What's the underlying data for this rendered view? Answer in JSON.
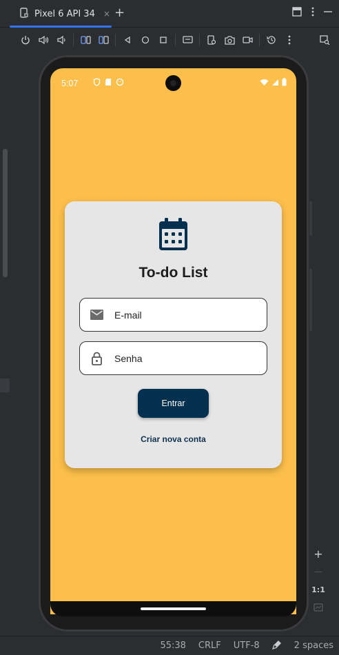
{
  "ide": {
    "tab_title": "Pixel 6 API 34",
    "tab_close": "×",
    "add_tab": "+",
    "status": {
      "position": "55:38",
      "line_ending": "CRLF",
      "encoding": "UTF-8",
      "indent": "2 spaces"
    },
    "zoom": {
      "in": "+",
      "out": "—",
      "actual_size": "1:1"
    }
  },
  "device": {
    "statusbar": {
      "time": "5:07"
    }
  },
  "app": {
    "title": "To-do List",
    "email_placeholder": "E-mail",
    "password_placeholder": "Senha",
    "login_button": "Entrar",
    "create_account_link": "Criar nova conta"
  },
  "colors": {
    "screen_background": "#fcbf4b",
    "card_background": "#e6e6e6",
    "primary": "#04304f"
  }
}
